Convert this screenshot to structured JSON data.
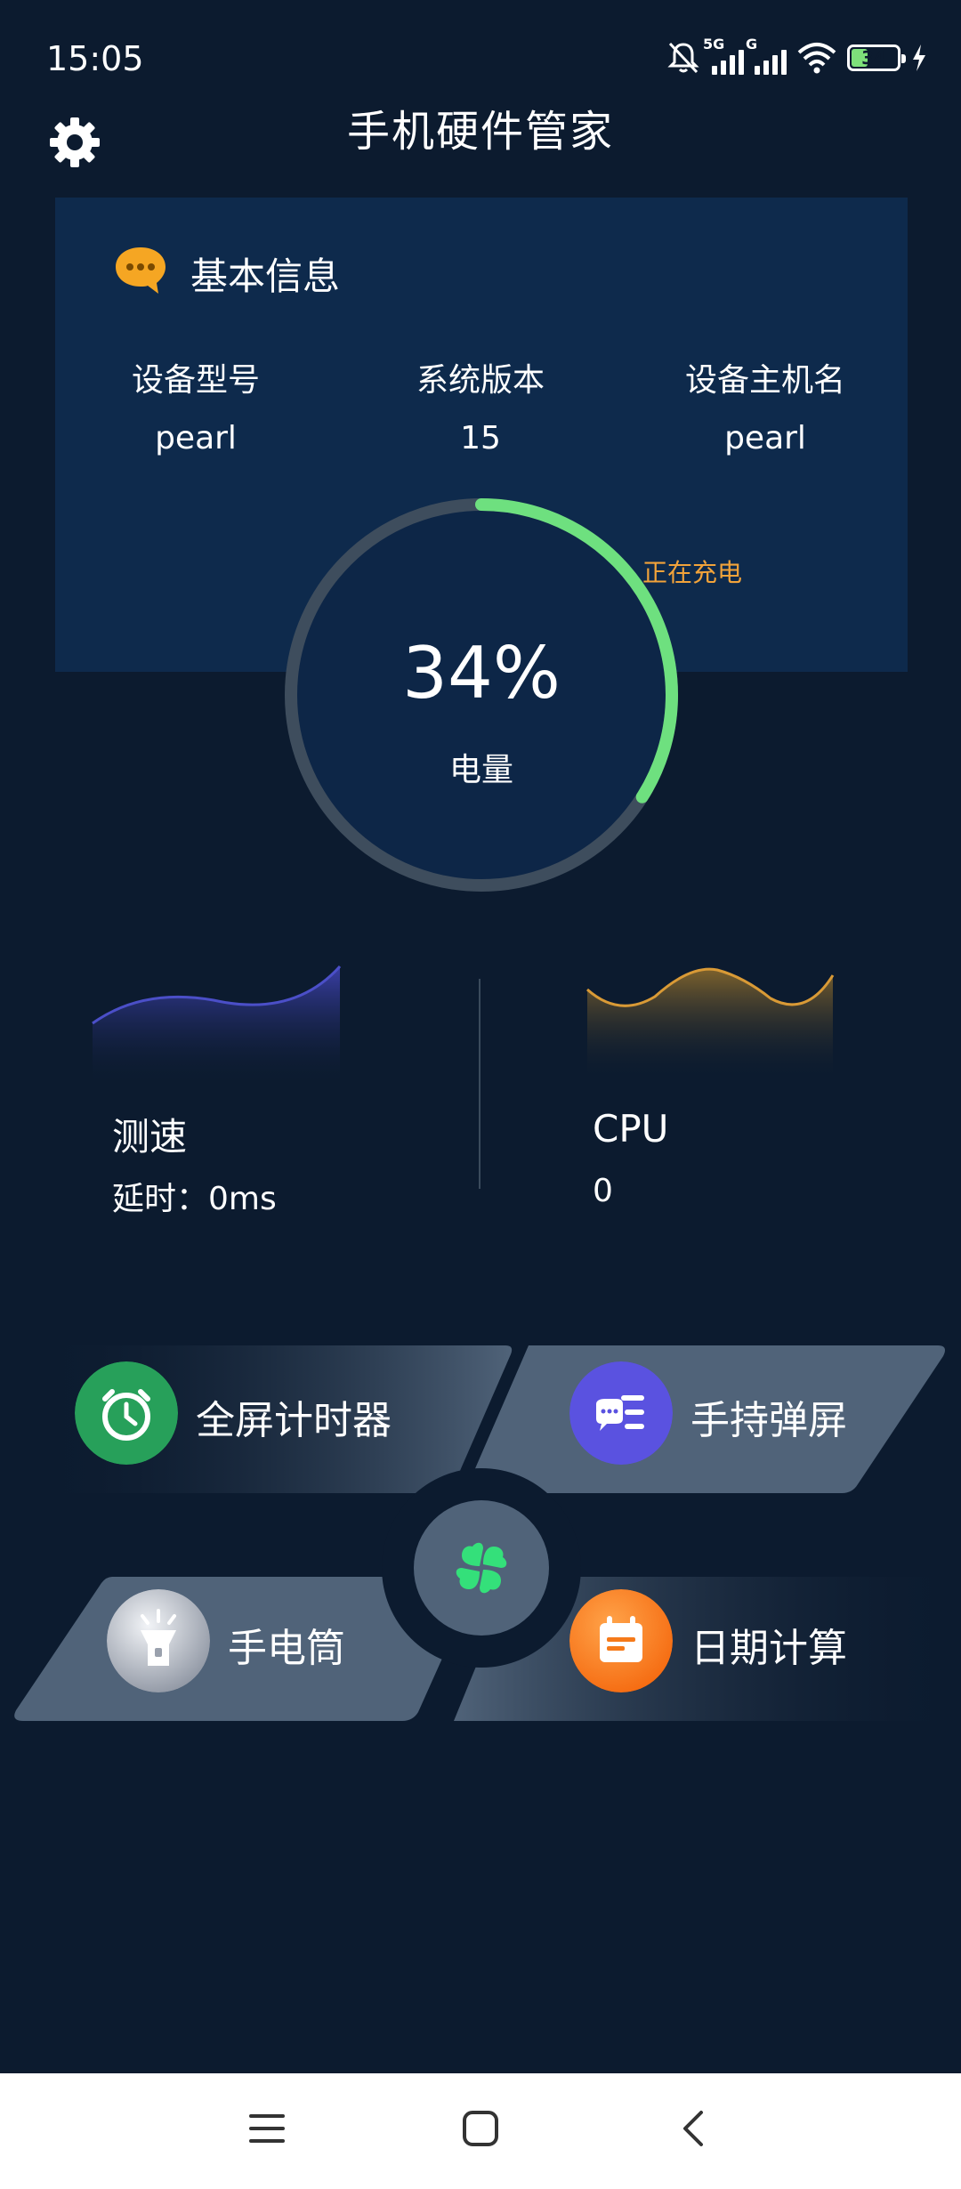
{
  "status_bar": {
    "time": "15:05",
    "signal1_label": "5G",
    "signal2_label": "G",
    "battery_level": "34"
  },
  "header": {
    "title": "手机硬件管家",
    "settings_icon": "gear-icon"
  },
  "info_card": {
    "title": "基本信息",
    "icon": "chat-bubble-icon",
    "columns": [
      {
        "label": "设备型号",
        "value": "pearl"
      },
      {
        "label": "系统版本",
        "value": "15"
      },
      {
        "label": "设备主机名",
        "value": "pearl"
      }
    ]
  },
  "battery": {
    "percent_text": "34%",
    "percent_value": 34,
    "label": "电量",
    "status": "正在充电",
    "ring_color": "#6ee07f",
    "status_color": "#f2a33a"
  },
  "stats": {
    "speed": {
      "name": "测速",
      "value": "延时：0ms"
    },
    "cpu": {
      "name": "CPU",
      "value": "0"
    }
  },
  "tiles": [
    {
      "label": "全屏计时器",
      "icon": "alarm-clock-icon",
      "color": "#27a05a"
    },
    {
      "label": "手持弹屏",
      "icon": "chat-list-icon",
      "color": "#5a52e0"
    },
    {
      "label": "手电筒",
      "icon": "flashlight-icon",
      "color": "#c8ccd4"
    },
    {
      "label": "日期计算",
      "icon": "calendar-icon",
      "color": "#f5821f"
    }
  ],
  "center_icon": "clover-icon",
  "nav": {
    "menu_icon": "menu-icon",
    "home_icon": "home-square-icon",
    "back_icon": "back-chevron-icon"
  }
}
